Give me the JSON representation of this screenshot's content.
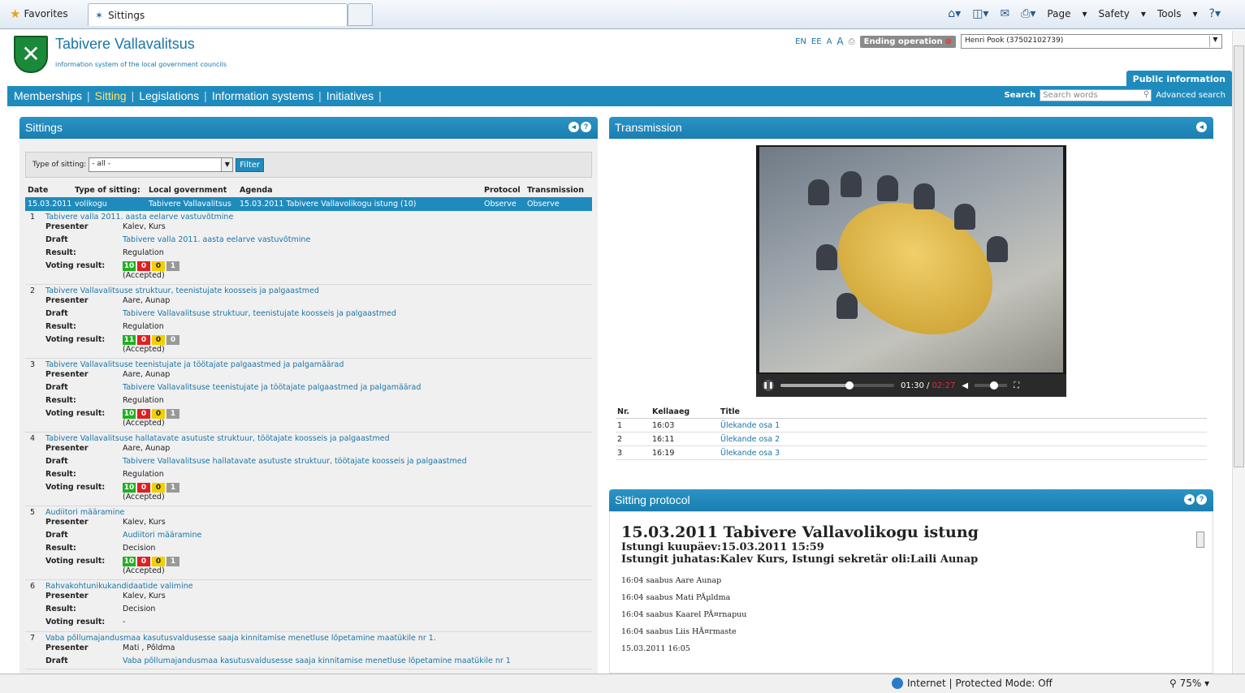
{
  "browser": {
    "favorites": "Favorites",
    "tab_title": "Sittings",
    "tools": [
      "Page",
      "Safety",
      "Tools"
    ]
  },
  "header": {
    "org_title": "Tabivere Vallavalitsus",
    "org_subtitle": "information system of the local government councils",
    "langs": [
      "EN",
      "EE"
    ],
    "font_controls": [
      "A",
      "A"
    ],
    "ending_operation": "Ending operation",
    "user": "Henri Pook (37502102739)",
    "public_info": "Public information"
  },
  "nav": {
    "items": [
      "Memberships",
      "Sitting",
      "Legislations",
      "Information systems",
      "Initiatives"
    ],
    "active": "Sitting",
    "search_label": "Search",
    "search_placeholder": "Search words",
    "advanced": "Advanced search"
  },
  "sittings": {
    "title": "Sittings",
    "filter_label": "Type of sitting:",
    "filter_value": "- all -",
    "filter_button": "Filter",
    "columns": [
      "Date",
      "Type of sitting:",
      "Local government",
      "Agenda",
      "Protocol",
      "Transmission"
    ],
    "selected_row": {
      "date": "15.03.2011",
      "type": "volikogu",
      "gov": "Tabivere Vallavalitsus",
      "agenda": "15.03.2011 Tabivere Vallavolikogu istung (10)",
      "protocol": "Observe",
      "transmission": "Observe"
    },
    "labels": {
      "presenter": "Presenter",
      "draft": "Draft",
      "result": "Result:",
      "voting": "Voting result:"
    },
    "items": [
      {
        "num": "1",
        "title": "Tabivere valla 2011. aasta eelarve vastuvõtmine",
        "presenter": "Kalev, Kurs",
        "draft": "Tabivere valla 2011. aasta eelarve vastuvõtmine",
        "result": "Regulation",
        "votes": [
          "10",
          "0",
          "0",
          "1"
        ],
        "status": "(Accepted)"
      },
      {
        "num": "2",
        "title": "Tabivere Vallavalitsuse struktuur, teenistujate koosseis ja palgaastmed",
        "presenter": "Aare, Aunap",
        "draft": "Tabivere Vallavalitsuse struktuur, teenistujate koosseis ja palgaastmed",
        "result": "Regulation",
        "votes": [
          "11",
          "0",
          "0",
          "0"
        ],
        "status": "(Accepted)"
      },
      {
        "num": "3",
        "title": "Tabivere Vallavalitsuse teenistujate ja töötajate palgaastmed ja palgamäärad",
        "presenter": "Aare, Aunap",
        "draft": "Tabivere Vallavalitsuse teenistujate ja töötajate palgaastmed ja palgamäärad",
        "result": "Regulation",
        "votes": [
          "10",
          "0",
          "0",
          "1"
        ],
        "status": "(Accepted)"
      },
      {
        "num": "4",
        "title": "Tabivere Vallavalitsuse hallatavate asutuste struktuur, töötajate koosseis ja palgaastmed",
        "presenter": "Aare, Aunap",
        "draft": "Tabivere Vallavalitsuse hallatavate asutuste struktuur, töötajate koosseis ja palgaastmed",
        "result": "Regulation",
        "votes": [
          "10",
          "0",
          "0",
          "1"
        ],
        "status": "(Accepted)"
      },
      {
        "num": "5",
        "title": "Audiitori määramine",
        "presenter": "Kalev, Kurs",
        "draft": "Audiitori määramine",
        "result": "Decision",
        "votes": [
          "10",
          "0",
          "0",
          "1"
        ],
        "status": "(Accepted)"
      },
      {
        "num": "6",
        "title": "Rahvakohtunikukandidaatide valimine",
        "presenter": "Kalev, Kurs",
        "draft": "",
        "result": "Decision",
        "votes": [],
        "status": "-"
      },
      {
        "num": "7",
        "title": "Vaba põllumajandusmaa kasutusvaldusesse saaja kinnitamise menetluse lõpetamine maatükile nr 1.",
        "presenter": "Mati , Põldma",
        "draft": "Vaba põllumajandusmaa kasutusvaldusesse saaja kinnitamise menetluse lõpetamine maatükile nr 1",
        "result": "",
        "votes": [],
        "status": ""
      }
    ]
  },
  "transmission": {
    "title": "Transmission",
    "time_current": "01:30",
    "time_sep": " / ",
    "time_total": "02:27",
    "progress": 0.61,
    "volume": 0.6,
    "columns": [
      "Nr.",
      "Kellaaeg",
      "Title"
    ],
    "rows": [
      {
        "nr": "1",
        "time": "16:03",
        "title": "Ülekande osa 1"
      },
      {
        "nr": "2",
        "time": "16:11",
        "title": "Ülekande osa 2"
      },
      {
        "nr": "3",
        "time": "16:19",
        "title": "Ülekande osa 3"
      }
    ]
  },
  "protocol": {
    "title": "Sitting protocol",
    "heading": "15.03.2011 Tabivere Vallavolikogu istung",
    "date_line": "Istungi kuupäev:15.03.2011 15:59",
    "chair_line": "Istungit juhatas:Kalev Kurs, Istungi sekretär oli:Laili Aunap",
    "log": [
      "16:04 saabus Aare Aunap",
      "16:04 saabus Mati PÃµldma",
      "16:04 saabus Kaarel PÃ¤rnapuu",
      "16:04 saabus Liis HÃ¤rmaste",
      "15.03.2011 16:05"
    ]
  },
  "status": {
    "zone": "Internet | Protected Mode: Off",
    "zoom": "75%"
  },
  "colors": {
    "brand": "#1f8bbd",
    "link": "#1a75a8",
    "vote_for": "#21b021",
    "vote_against": "#e02020",
    "vote_abstain": "#f2d000",
    "vote_absent": "#999999"
  }
}
